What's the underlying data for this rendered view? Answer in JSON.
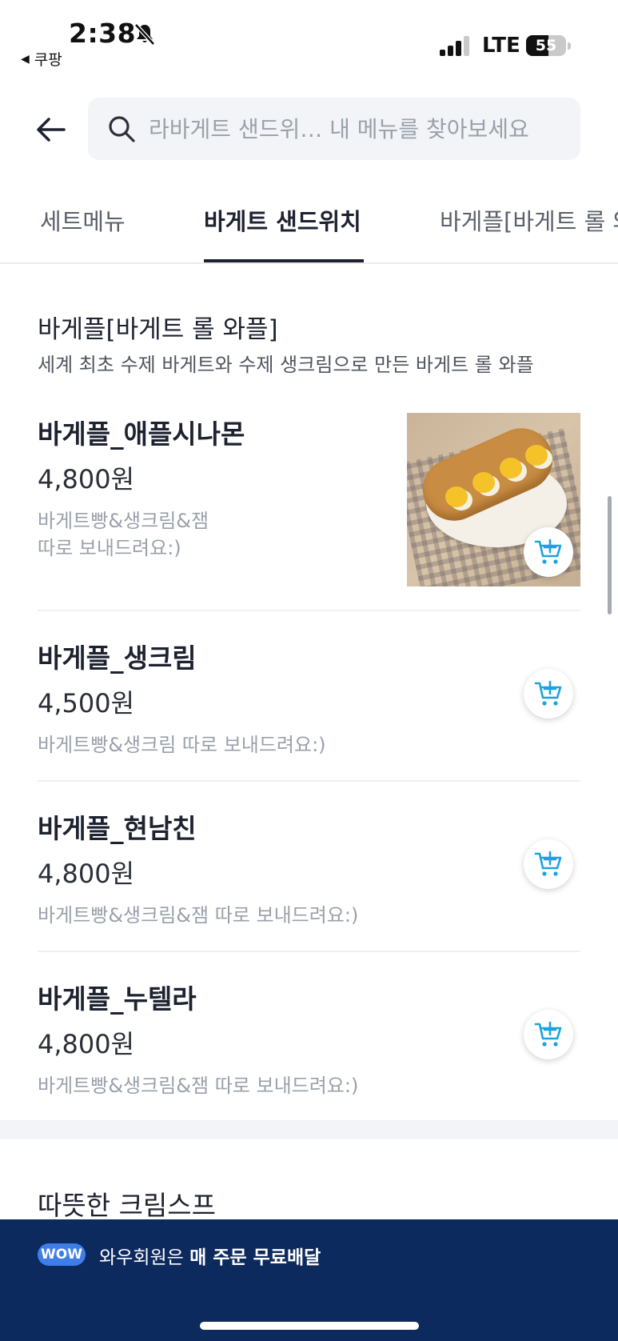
{
  "status_bar": {
    "time": "2:38",
    "back_app": "쿠팡",
    "network": "LTE",
    "battery": "55",
    "battery_level": 0.55
  },
  "header": {
    "search_placeholder": "라바게트 샌드위… 내 메뉴를 찾아보세요"
  },
  "tabs": [
    {
      "label": "세트메뉴",
      "active": false
    },
    {
      "label": "바게트 샌드위치",
      "active": true
    },
    {
      "label": "바게플[바게트 롤 와플]",
      "active": false
    }
  ],
  "section": {
    "title": "바게플[바게트 롤 와플]",
    "description": "세계 최초 수제 바게트와 수제 생크림으로 만든 바게트 롤 와플"
  },
  "menu_items": [
    {
      "name": "바게플_애플시나몬",
      "price": "4,800원",
      "description": "바게트빵&생크림&잼\n따로 보내드려요:)",
      "has_photo": true
    },
    {
      "name": "바게플_생크림",
      "price": "4,500원",
      "description": "바게트빵&생크림 따로 보내드려요:)",
      "has_photo": false
    },
    {
      "name": "바게플_현남친",
      "price": "4,800원",
      "description": "바게트빵&생크림&잼 따로 보내드려요:)",
      "has_photo": false
    },
    {
      "name": "바게플_누텔라",
      "price": "4,800원",
      "description": "바게트빵&생크림&잼 따로 보내드려요:)",
      "has_photo": false
    }
  ],
  "next_section": {
    "title": "따뜻한 크림스프"
  },
  "wow_banner": {
    "badge": "WOW",
    "text_prefix": "와우회원은 ",
    "text_bold": "매 주문 무료배달"
  },
  "colors": {
    "accent_cart": "#1aa3e0",
    "banner_bg": "#0d2a5e",
    "wow_badge": "#3f7ee8"
  },
  "icons": [
    "bell-slash-icon",
    "signal-icon",
    "back-arrow-icon",
    "search-icon",
    "cart-add-icon"
  ]
}
